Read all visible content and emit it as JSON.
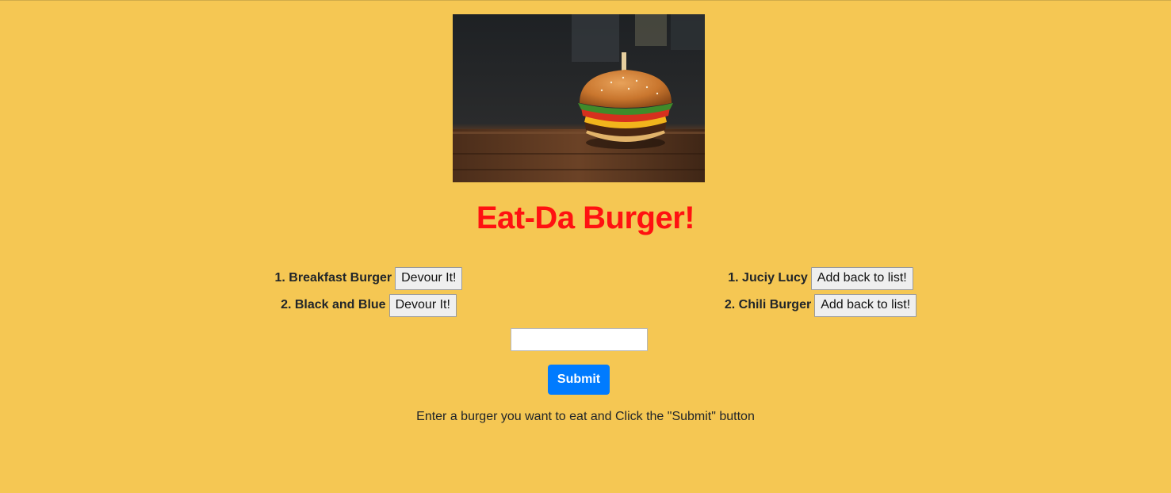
{
  "hero": {
    "alt": "burger-photo"
  },
  "title": "Eat-Da Burger!",
  "uneaten": [
    {
      "label": "1. Breakfast Burger",
      "button": "Devour It!"
    },
    {
      "label": "2. Black and Blue",
      "button": "Devour It!"
    }
  ],
  "devoured": [
    {
      "label": "1. Juciy Lucy",
      "button": "Add back to list!"
    },
    {
      "label": "2. Chili Burger",
      "button": "Add back to list!"
    }
  ],
  "form": {
    "input_value": "",
    "submit_label": "Submit",
    "hint": "Enter a burger you want to eat and Click the \"Submit\" button"
  },
  "colors": {
    "background": "#f5c753",
    "title": "#ff1111",
    "primary": "#007bff"
  }
}
